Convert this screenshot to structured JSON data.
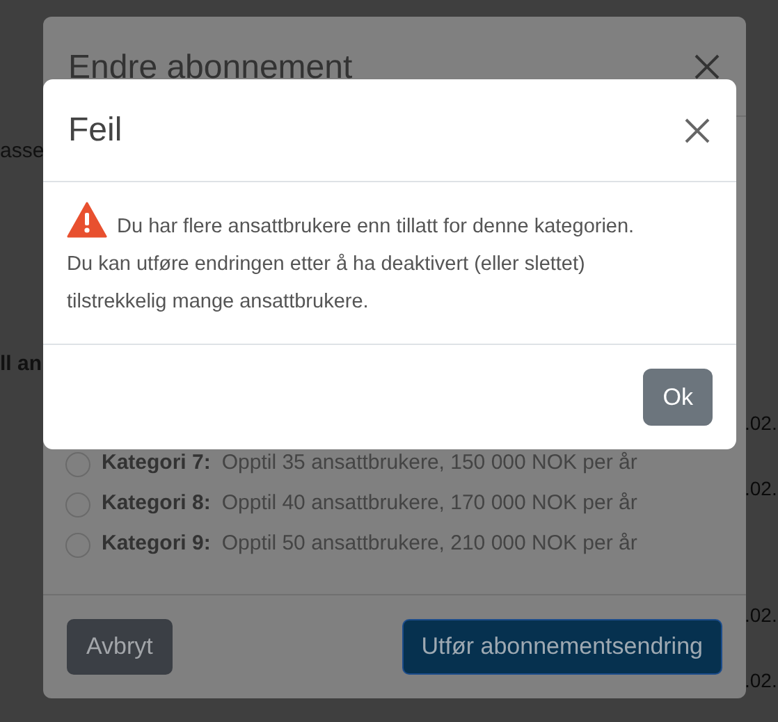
{
  "background": {
    "left_fragments": [
      {
        "text": "asse",
        "bold": false
      },
      {
        "text": "ll an",
        "bold": true
      }
    ],
    "right_fragments": [
      ".02.",
      ".02.",
      ".02.",
      ".02."
    ]
  },
  "dialog": {
    "title": "Endre abonnement",
    "options": [
      {
        "label": "Kategori 7:",
        "description": "Opptil 35 ansattbrukere, 150 000 NOK per år",
        "selected": false
      },
      {
        "label": "Kategori 8:",
        "description": "Opptil 40 ansattbrukere, 170 000 NOK per år",
        "selected": false
      },
      {
        "label": "Kategori 9:",
        "description": "Opptil 50 ansattbrukere, 210 000 NOK per år",
        "selected": false
      }
    ],
    "buttons": [
      {
        "label": "Avbryt",
        "kind": "secondary"
      },
      {
        "label": "Utfør abonnementsendring",
        "kind": "primary"
      }
    ]
  },
  "error_dialog": {
    "title": "Feil",
    "message": "Du har flere ansattbrukere enn tillatt for denne kategorien. Du kan utføre endringen etter å ha deaktivert (eller slettet) tilstrekkelig mange ansattbrukere.",
    "buttons": [
      {
        "label": "Ok"
      }
    ]
  }
}
